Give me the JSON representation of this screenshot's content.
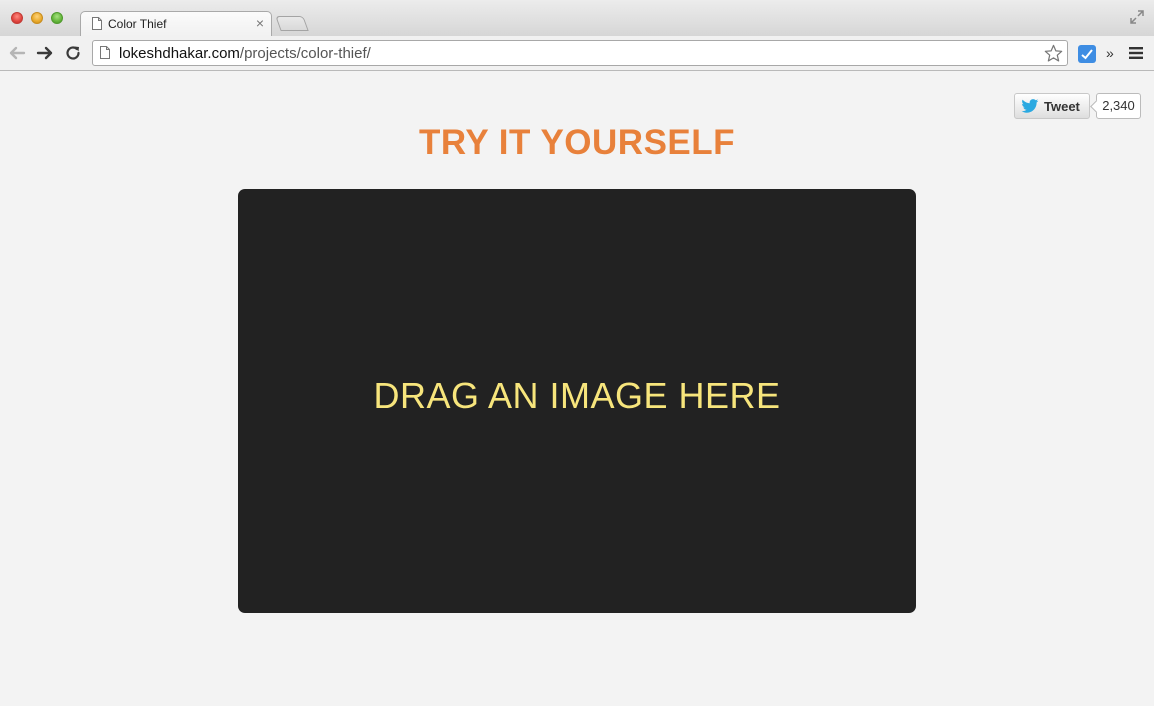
{
  "browser": {
    "tab": {
      "title": "Color Thief",
      "close_glyph": "×"
    },
    "address_bar": {
      "domain": "lokeshdhakar.com",
      "path": "/projects/color-thief/"
    },
    "toolbar": {
      "extensions_overflow": "»"
    },
    "icons": [
      "back-icon",
      "forward-icon",
      "reload-icon",
      "page-icon",
      "star-icon",
      "extension-icon",
      "menu-icon",
      "fullscreen-icon"
    ]
  },
  "page": {
    "tweet": {
      "label": "Tweet",
      "count": "2,340"
    },
    "heading": "TRY IT YOURSELF",
    "dropzone": {
      "label": "DRAG AN IMAGE HERE"
    }
  },
  "colors": {
    "heading": "#e8813b",
    "dropzone_bg": "#222222",
    "dropzone_text": "#f7e57c",
    "page_bg": "#f3f3f3"
  }
}
